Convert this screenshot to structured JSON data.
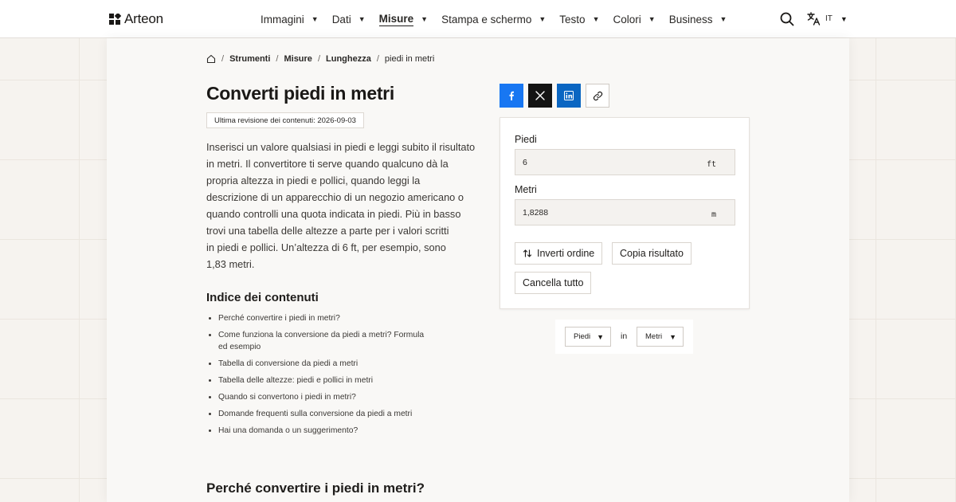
{
  "brand": {
    "name": "Arteon"
  },
  "nav": {
    "items": [
      {
        "label": "Immagini",
        "active": false
      },
      {
        "label": "Dati",
        "active": false
      },
      {
        "label": "Misure",
        "active": true
      },
      {
        "label": "Stampa e schermo",
        "active": false
      },
      {
        "label": "Testo",
        "active": false
      },
      {
        "label": "Colori",
        "active": false
      },
      {
        "label": "Business",
        "active": false
      }
    ],
    "search_icon": "search-icon",
    "language_icon": "translate-icon",
    "language_code": "IT"
  },
  "breadcrumb": {
    "home_icon": "home-icon",
    "items": [
      "Strumenti",
      "Misure",
      "Lunghezza"
    ],
    "current": "piedi in metri"
  },
  "page": {
    "title": "Converti piedi in metri",
    "revision": "Ultima revisione dei contenuti: 2026-09-03",
    "intro_lines": [
      "Inserisci un valore qualsiasi in piedi e leggi subito il risultato",
      "in metri. Il convertitore ti serve quando qualcuno dà la",
      "propria altezza in piedi e pollici, quando leggi la",
      "descrizione di un apparecchio di un negozio americano o",
      "quando controlli una quota indicata in piedi. Più in basso",
      "trovi una tabella delle altezze a parte per i valori scritti",
      "in piedi e pollici. Un’altezza di 6 ft, per esempio, sono",
      "1,83 metri."
    ],
    "toc_title": "Indice dei contenuti",
    "toc": [
      [
        "Perché convertire i piedi in metri?"
      ],
      [
        "Come funziona la conversione da piedi a metri? Formula",
        "ed esempio"
      ],
      [
        "Tabella di conversione da piedi a metri"
      ],
      [
        "Tabella delle altezze: piedi e pollici in metri"
      ],
      [
        "Quando si convertono i piedi in metri?"
      ],
      [
        "Domande frequenti sulla conversione da piedi a metri"
      ],
      [
        "Hai una domanda o un suggerimento?"
      ]
    ],
    "section_title": "Perché convertire i piedi in metri?"
  },
  "share": {
    "buttons": [
      "facebook-icon",
      "x-icon",
      "linkedin-icon",
      "link-icon"
    ],
    "colors": {
      "facebook": "#1877f2",
      "x": "#141414",
      "linkedin": "#0a66c2"
    }
  },
  "converter": {
    "from_label": "Piedi",
    "from_value": "6",
    "from_unit": "ft",
    "to_label": "Metri",
    "to_value": "1,8288",
    "to_unit": "m",
    "swap_label": "Inverti ordine",
    "copy_label": "Copia risultato",
    "clear_label": "Cancella tutto"
  },
  "unit_selector": {
    "from": "Piedi",
    "in_label": "in",
    "to": "Metri"
  }
}
